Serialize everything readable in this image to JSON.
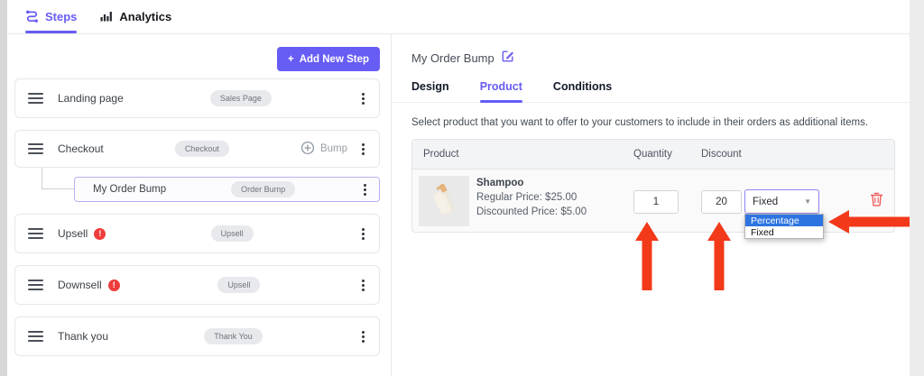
{
  "colors": {
    "accent": "#675CF4",
    "arrow": "#F2391A",
    "dropdown_highlight": "#2E74E0",
    "danger": "#EF5B5B",
    "badge_bg": "#E8E9EC"
  },
  "topbar": {
    "tabs": [
      {
        "label": "Steps",
        "icon": "flow-steps-icon",
        "active": true
      },
      {
        "label": "Analytics",
        "icon": "bar-chart-icon",
        "active": false
      }
    ]
  },
  "left_panel": {
    "add_button": {
      "plus": "+",
      "label": "Add New Step"
    },
    "steps": [
      {
        "label": "Landing page",
        "badge": "Sales Page"
      },
      {
        "label": "Checkout",
        "badge": "Checkout",
        "bump_label": "Bump"
      },
      {
        "label": "My Order Bump",
        "badge": "Order Bump",
        "selected": true
      },
      {
        "label": "Upsell",
        "badge": "Upsell",
        "warning": "!"
      },
      {
        "label": "Downsell",
        "badge": "Upsell",
        "warning": "!"
      },
      {
        "label": "Thank you",
        "badge": "Thank You"
      }
    ]
  },
  "right_panel": {
    "title": "My Order Bump",
    "tabs": [
      {
        "label": "Design",
        "active": false
      },
      {
        "label": "Product",
        "active": true
      },
      {
        "label": "Conditions",
        "active": false
      }
    ],
    "description": "Select product that you want to offer to your customers to include in their orders as additional items.",
    "table": {
      "headers": [
        "Product",
        "Quantity",
        "Discount"
      ],
      "row": {
        "name": "Shampoo",
        "regular_price": "Regular Price: $25.00",
        "discounted_price": "Discounted Price: $5.00",
        "quantity": "1",
        "discount": "20",
        "discount_type": "Fixed",
        "chevron": "▼"
      },
      "dropdown": {
        "options": [
          "Percentage",
          "Fixed"
        ],
        "highlighted": "Percentage"
      }
    }
  },
  "icons": {
    "flow_steps": "flow-steps-icon",
    "bar_chart": "bar-chart-icon",
    "drag_handle": "drag-handle-icon",
    "kebab_menu": "kebab-menu-icon",
    "warning": "warning-icon",
    "plus_circle": "plus-circle-icon",
    "edit_pencil": "edit-icon",
    "trash": "trash-icon"
  }
}
